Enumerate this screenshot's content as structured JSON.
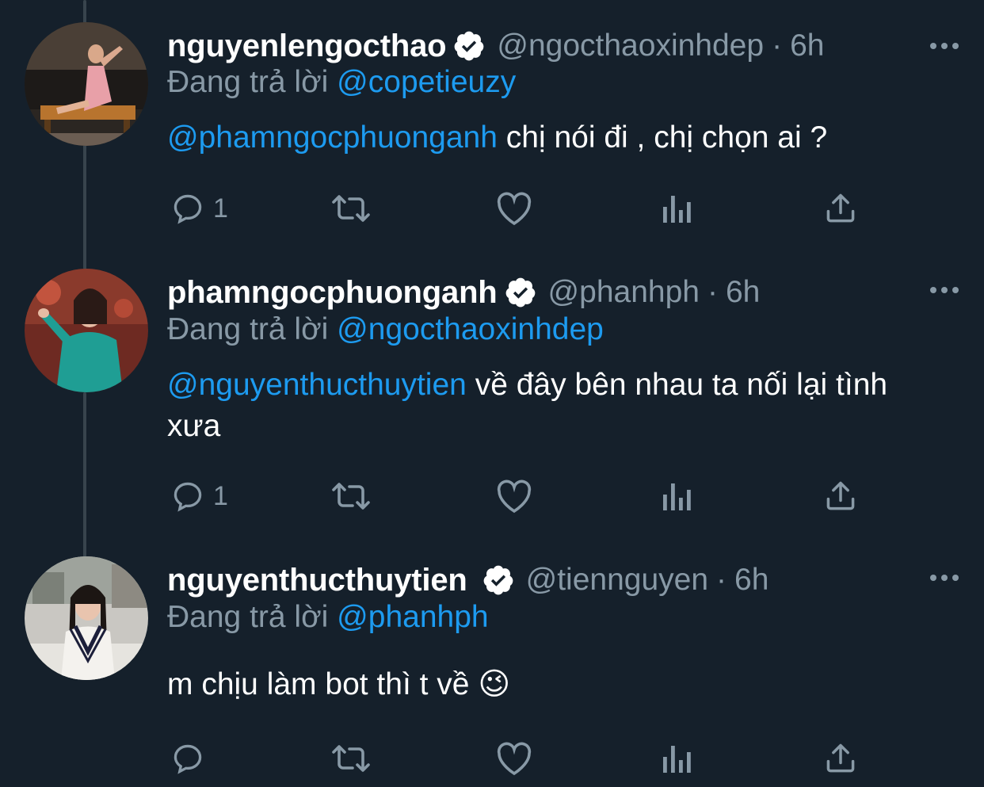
{
  "tweets": [
    {
      "display_name": "nguyenlengocthao",
      "handle": "@ngocthaoxinhdep",
      "separator": "·",
      "time": "6h",
      "reply_prefix": "Đang trả lời",
      "reply_to": "@copetieuzy",
      "mention": "@phamngocphuonganh",
      "text": " chị nói đi , chị chọn ai ?",
      "reply_count": "1",
      "verified": true
    },
    {
      "display_name": "phamngocphuonganh",
      "handle": "@phanhph",
      "separator": "·",
      "time": "6h",
      "reply_prefix": "Đang trả lời",
      "reply_to": "@ngocthaoxinhdep",
      "mention": "@nguyenthucthuytien",
      "text": " về đây bên nhau ta nối lại tình xưa",
      "reply_count": "1",
      "verified": true
    },
    {
      "display_name": "nguyenthucthuytien",
      "handle": "@tiennguyen",
      "separator": "·",
      "time": "6h",
      "reply_prefix": "Đang trả lời",
      "reply_to": "@phanhph",
      "mention": "",
      "text": "m chịu làm bot thì t về",
      "emoji": "😉",
      "reply_count": "",
      "verified": true
    }
  ],
  "colors": {
    "background": "#15202b",
    "primary_text": "#ffffff",
    "secondary_text": "#8899a6",
    "link": "#1d9bf0",
    "thread_line": "#38444d"
  },
  "icons": [
    "reply-icon",
    "retweet-icon",
    "like-icon",
    "analytics-icon",
    "share-icon",
    "more-icon",
    "verified-badge-icon"
  ]
}
